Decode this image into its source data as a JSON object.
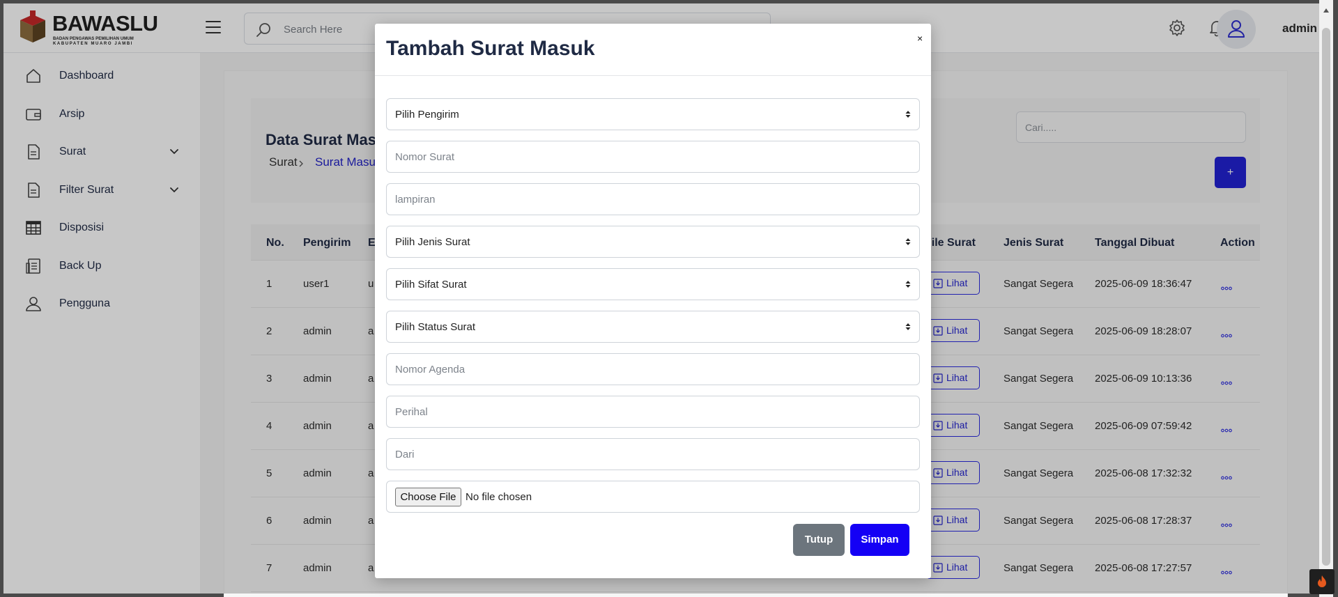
{
  "brand": {
    "title": "BAWASLU",
    "subtitle_1": "BADAN PENGAWAS PEMILIHAN UMUM",
    "subtitle_2": "KABUPATEN MUARO JAMBI"
  },
  "header": {
    "search_placeholder": "Search Here",
    "user_name": "admin",
    "icons": [
      "menu-icon",
      "search-icon",
      "gear-icon",
      "bell-icon",
      "user-icon"
    ]
  },
  "sidebar": {
    "items": [
      {
        "label": "Dashboard",
        "icon": "home-icon"
      },
      {
        "label": "Arsip",
        "icon": "wallet-icon"
      },
      {
        "label": "Surat",
        "icon": "document-icon",
        "has_submenu": true
      },
      {
        "label": "Filter Surat",
        "icon": "document-icon",
        "has_submenu": true
      },
      {
        "label": "Disposisi",
        "icon": "table-icon"
      },
      {
        "label": "Back Up",
        "icon": "server-icon"
      },
      {
        "label": "Pengguna",
        "icon": "user-icon"
      }
    ]
  },
  "page": {
    "title": "Data Surat Masuk",
    "breadcrumb": [
      "Surat",
      "Surat Masuk"
    ],
    "search_placeholder": "Cari.....",
    "add_label": "+"
  },
  "table": {
    "columns": [
      "No.",
      "Pengirim",
      "E",
      "File Surat",
      "Jenis Surat",
      "Tanggal Dibuat",
      "Action"
    ],
    "rows": [
      {
        "no": "1",
        "pengirim": "user1",
        "e": "u",
        "file": "Lihat",
        "jenis": "Sangat Segera",
        "tanggal": "2025-06-09 18:36:47"
      },
      {
        "no": "2",
        "pengirim": "admin",
        "e": "a",
        "file": "Lihat",
        "jenis": "Sangat Segera",
        "tanggal": "2025-06-09 18:28:07"
      },
      {
        "no": "3",
        "pengirim": "admin",
        "e": "a",
        "file": "Lihat",
        "jenis": "Sangat Segera",
        "tanggal": "2025-06-09 10:13:36"
      },
      {
        "no": "4",
        "pengirim": "admin",
        "e": "a",
        "file": "Lihat",
        "jenis": "Sangat Segera",
        "tanggal": "2025-06-09 07:59:42"
      },
      {
        "no": "5",
        "pengirim": "admin",
        "e": "a",
        "file": "Lihat",
        "jenis": "Sangat Segera",
        "tanggal": "2025-06-08 17:32:32"
      },
      {
        "no": "6",
        "pengirim": "admin",
        "e": "a",
        "file": "Lihat",
        "jenis": "Sangat Segera",
        "tanggal": "2025-06-08 17:28:37"
      },
      {
        "no": "7",
        "pengirim": "admin",
        "e": "a",
        "file": "Lihat",
        "jenis": "Sangat Segera",
        "tanggal": "2025-06-08 17:27:57"
      }
    ]
  },
  "modal": {
    "title": "Tambah Surat Masuk",
    "close": "×",
    "fields": {
      "pengirim": "Pilih Pengirim",
      "nomor_surat": "Nomor Surat",
      "lampiran": "lampiran",
      "jenis_surat": "Pilih Jenis Surat",
      "sifat_surat": "Pilih Sifat Surat",
      "status_surat": "Pilih Status Surat",
      "nomor_agenda": "Nomor Agenda",
      "perihal": "Perihal",
      "dari": "Dari"
    },
    "file_button": "Choose File",
    "file_status": "No file chosen",
    "cancel_label": "Tutup",
    "submit_label": "Simpan"
  },
  "colors": {
    "primary": "#1400f5",
    "secondary": "#6c757d",
    "link": "#2323c8"
  }
}
